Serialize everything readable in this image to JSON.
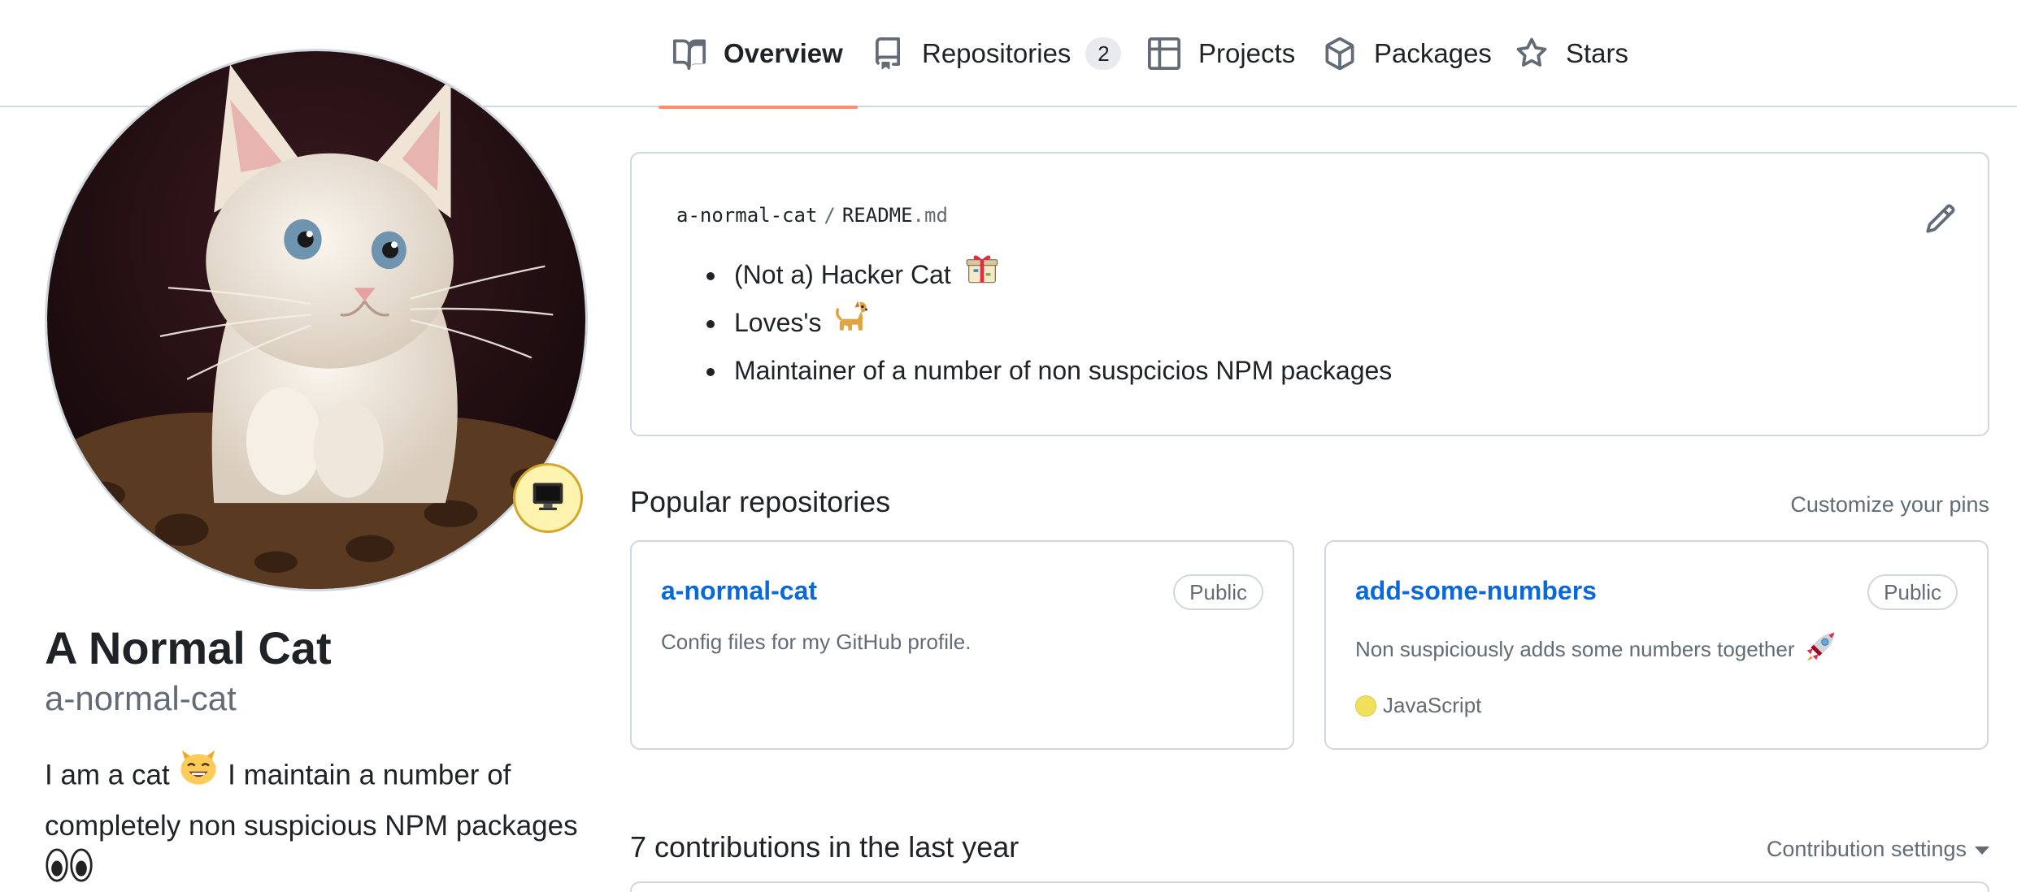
{
  "nav": {
    "tabs": [
      {
        "label": "Overview",
        "icon": "book-icon",
        "active": true
      },
      {
        "label": "Repositories",
        "icon": "repo-icon",
        "count": "2"
      },
      {
        "label": "Projects",
        "icon": "table-icon"
      },
      {
        "label": "Packages",
        "icon": "package-icon"
      },
      {
        "label": "Stars",
        "icon": "star-icon"
      }
    ]
  },
  "profile": {
    "name": "A Normal Cat",
    "username": "a-normal-cat",
    "bio_part1": "I am a cat",
    "bio_part2": "I maintain a number of completely non suspicious NPM packages",
    "status_icon": "computer-icon"
  },
  "readme": {
    "owner": "a-normal-cat",
    "separator": "/",
    "file_base": "README",
    "file_ext": ".md",
    "items": [
      "(Not a) Hacker Cat",
      "Loves's",
      "Maintainer of a number of non suspcicios NPM packages"
    ]
  },
  "popular": {
    "title": "Popular repositories",
    "customize_label": "Customize your pins",
    "repos": [
      {
        "name": "a-normal-cat",
        "visibility": "Public",
        "description": "Config files for my GitHub profile."
      },
      {
        "name": "add-some-numbers",
        "visibility": "Public",
        "description": "Non suspiciously adds some numbers together",
        "language": "JavaScript",
        "language_color": "#f1e05a"
      }
    ]
  },
  "contributions": {
    "title": "7 contributions in the last year",
    "settings_label": "Contribution settings"
  },
  "colors": {
    "accent_underline": "#fd8c73",
    "link": "#0969da",
    "muted": "#636c76",
    "border": "#d0d7de"
  }
}
